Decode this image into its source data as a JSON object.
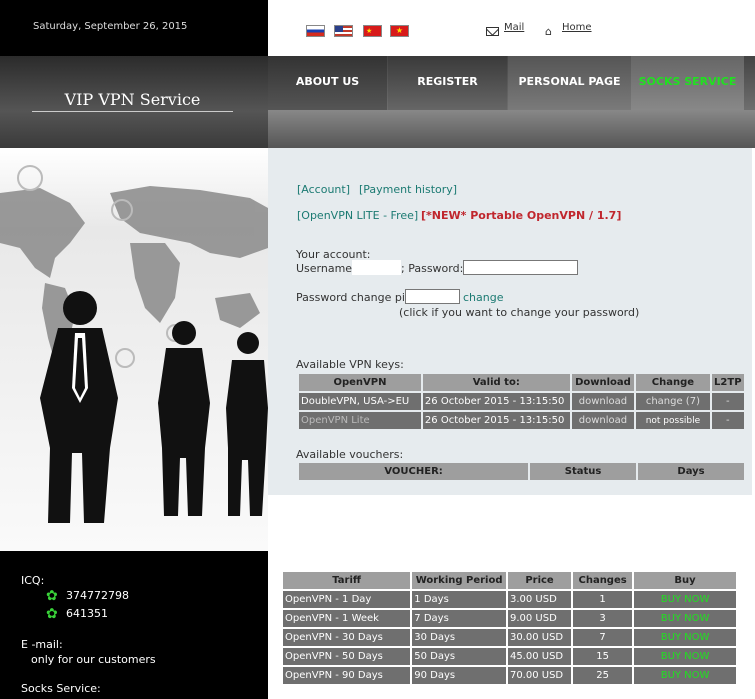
{
  "header": {
    "date": "Saturday, September 26, 2015",
    "mail_label": "Mail",
    "home_label": "Home",
    "brand": "VIP VPN Service"
  },
  "nav": [
    {
      "label": "ABOUT US",
      "color": "#ffffff"
    },
    {
      "label": "REGISTER",
      "color": "#ffffff"
    },
    {
      "label": "PERSONAL PAGE",
      "color": "#ffffff"
    },
    {
      "label": "SOCKS SERVICE",
      "color": "#21e021"
    }
  ],
  "account": {
    "link_account": "[Account]",
    "link_payment_history": "[Payment history]",
    "link_openvpn_lite": "[OpenVPN LITE - Free]",
    "link_portable": "[*NEW* Portable OpenVPN / 1.7]",
    "your_account": "Your account:",
    "username_label": "Username:",
    "password_label": "; Password:",
    "pin_label": "Password change pin:",
    "change_link": "change",
    "change_hint": "(click if you want to change your password)"
  },
  "vpn_keys": {
    "title": "Available VPN keys:",
    "headers": [
      "OpenVPN",
      "Valid to:",
      "Download",
      "Change",
      "L2TP"
    ],
    "rows": [
      [
        "DoubleVPN, USA->EU",
        "26 October 2015 - 13:15:50",
        "download",
        "change (7)",
        "-"
      ],
      [
        "OpenVPN Lite",
        "26 October 2015 - 13:15:50",
        "download",
        "not possible",
        "-"
      ]
    ]
  },
  "vouchers": {
    "title": "Available vouchers:",
    "headers": [
      "VOUCHER:",
      "Status",
      "Days"
    ]
  },
  "contacts": {
    "icq_label": "ICQ:",
    "icq_numbers": [
      "374772798",
      "641351"
    ],
    "email_label": "E -mail:",
    "email_note": "only for our customers",
    "socks_label": "Socks Service:"
  },
  "tariffs": {
    "headers": [
      "Tariff",
      "Working Period",
      "Price",
      "Changes",
      "Buy"
    ],
    "rows": [
      [
        "OpenVPN - 1 Day",
        "1 Days",
        "3.00 USD",
        "1",
        "BUY NOW"
      ],
      [
        "OpenVPN - 1 Week",
        "7 Days",
        "9.00 USD",
        "3",
        "BUY NOW"
      ],
      [
        "OpenVPN - 30 Days",
        "30 Days",
        "30.00 USD",
        "7",
        "BUY NOW"
      ],
      [
        "OpenVPN - 50 Days",
        "50 Days",
        "45.00 USD",
        "15",
        "BUY NOW"
      ],
      [
        "OpenVPN - 90 Days",
        "90 Days",
        "70.00 USD",
        "25",
        "BUY NOW"
      ]
    ]
  }
}
